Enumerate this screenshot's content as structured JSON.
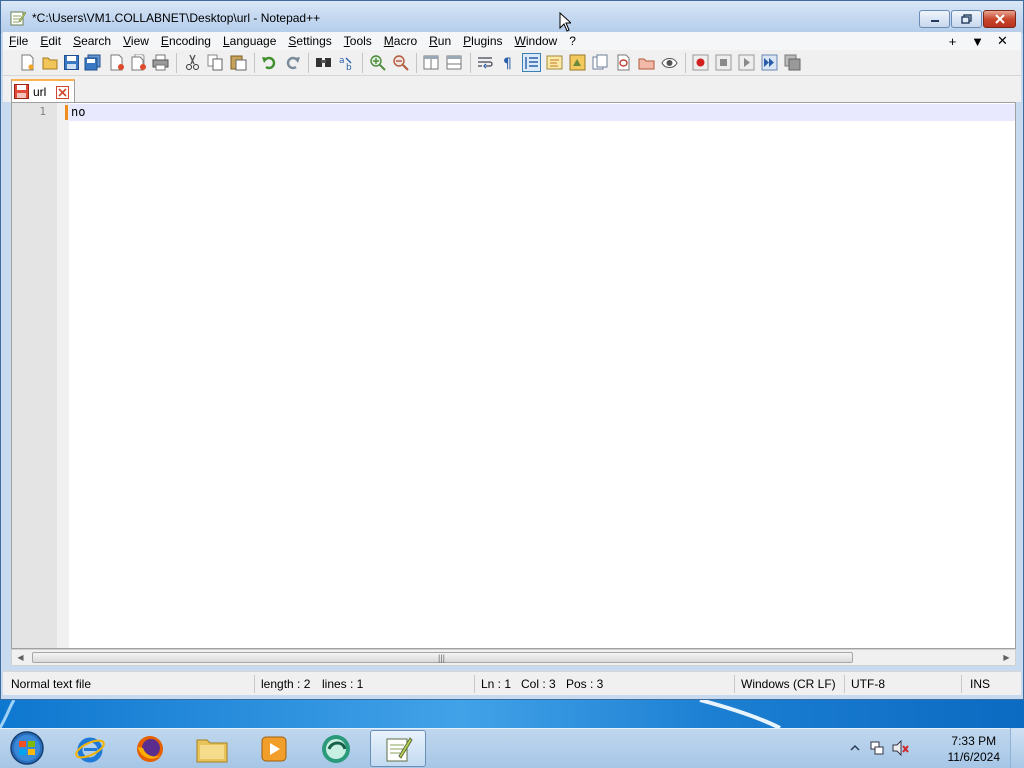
{
  "window": {
    "title": "*C:\\Users\\VM1.COLLABNET\\Desktop\\url - Notepad++"
  },
  "menu": {
    "items": [
      "File",
      "Edit",
      "Search",
      "View",
      "Encoding",
      "Language",
      "Settings",
      "Tools",
      "Macro",
      "Run",
      "Plugins",
      "Window",
      "?"
    ],
    "right": [
      "+",
      "▼",
      "✕"
    ]
  },
  "toolbar": {
    "icons": [
      "new-file-icon",
      "open-file-icon",
      "save-icon",
      "save-all-icon",
      "close-icon",
      "close-all-icon",
      "print-icon",
      "cut-icon",
      "copy-icon",
      "paste-icon",
      "undo-icon",
      "redo-icon",
      "find-icon",
      "replace-icon",
      "zoom-in-icon",
      "zoom-out-icon",
      "sync-vertical-icon",
      "sync-horizontal-icon",
      "word-wrap-icon",
      "show-all-characters-icon",
      "indent-guide-icon",
      "user-defined-language-icon",
      "document-map-icon",
      "function-list-icon",
      "folder-workspace-icon",
      "monitoring-icon",
      "record-macro-icon",
      "stop-recording-icon",
      "playback-macro-icon",
      "run-macro-multiple-icon",
      "save-macro-icon"
    ]
  },
  "tabs": [
    {
      "label": "url",
      "modified": true
    }
  ],
  "editor": {
    "lines": [
      {
        "number": "1",
        "text": "no"
      }
    ]
  },
  "statusbar": {
    "file_type": "Normal text file",
    "length": "length : 2",
    "lines": "lines : 1",
    "ln": "Ln : 1",
    "col": "Col : 3",
    "pos": "Pos : 3",
    "eol": "Windows (CR LF)",
    "encoding": "UTF-8",
    "mode": "INS"
  },
  "taskbar": {
    "apps": [
      "internet-explorer-icon",
      "firefox-icon",
      "file-explorer-icon",
      "media-player-icon",
      "app-icon",
      "notepadpp-icon"
    ],
    "active_app": "notepadpp-icon",
    "clock_time": "7:33 PM",
    "clock_date": "11/6/2024"
  },
  "colors": {
    "accent": "#fab252",
    "caret": "#f08c1c",
    "current_line": "#e8e8ff",
    "titlebar": "#c6d9f1"
  }
}
